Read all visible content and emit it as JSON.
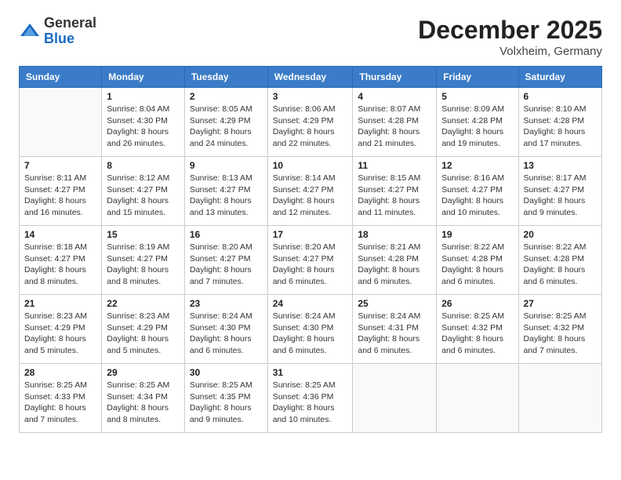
{
  "header": {
    "logo_general": "General",
    "logo_blue": "Blue",
    "month_title": "December 2025",
    "location": "Volxheim, Germany"
  },
  "days_of_week": [
    "Sunday",
    "Monday",
    "Tuesday",
    "Wednesday",
    "Thursday",
    "Friday",
    "Saturday"
  ],
  "weeks": [
    [
      {
        "day": "",
        "info": ""
      },
      {
        "day": "1",
        "info": "Sunrise: 8:04 AM\nSunset: 4:30 PM\nDaylight: 8 hours\nand 26 minutes."
      },
      {
        "day": "2",
        "info": "Sunrise: 8:05 AM\nSunset: 4:29 PM\nDaylight: 8 hours\nand 24 minutes."
      },
      {
        "day": "3",
        "info": "Sunrise: 8:06 AM\nSunset: 4:29 PM\nDaylight: 8 hours\nand 22 minutes."
      },
      {
        "day": "4",
        "info": "Sunrise: 8:07 AM\nSunset: 4:28 PM\nDaylight: 8 hours\nand 21 minutes."
      },
      {
        "day": "5",
        "info": "Sunrise: 8:09 AM\nSunset: 4:28 PM\nDaylight: 8 hours\nand 19 minutes."
      },
      {
        "day": "6",
        "info": "Sunrise: 8:10 AM\nSunset: 4:28 PM\nDaylight: 8 hours\nand 17 minutes."
      }
    ],
    [
      {
        "day": "7",
        "info": "Sunrise: 8:11 AM\nSunset: 4:27 PM\nDaylight: 8 hours\nand 16 minutes."
      },
      {
        "day": "8",
        "info": "Sunrise: 8:12 AM\nSunset: 4:27 PM\nDaylight: 8 hours\nand 15 minutes."
      },
      {
        "day": "9",
        "info": "Sunrise: 8:13 AM\nSunset: 4:27 PM\nDaylight: 8 hours\nand 13 minutes."
      },
      {
        "day": "10",
        "info": "Sunrise: 8:14 AM\nSunset: 4:27 PM\nDaylight: 8 hours\nand 12 minutes."
      },
      {
        "day": "11",
        "info": "Sunrise: 8:15 AM\nSunset: 4:27 PM\nDaylight: 8 hours\nand 11 minutes."
      },
      {
        "day": "12",
        "info": "Sunrise: 8:16 AM\nSunset: 4:27 PM\nDaylight: 8 hours\nand 10 minutes."
      },
      {
        "day": "13",
        "info": "Sunrise: 8:17 AM\nSunset: 4:27 PM\nDaylight: 8 hours\nand 9 minutes."
      }
    ],
    [
      {
        "day": "14",
        "info": "Sunrise: 8:18 AM\nSunset: 4:27 PM\nDaylight: 8 hours\nand 8 minutes."
      },
      {
        "day": "15",
        "info": "Sunrise: 8:19 AM\nSunset: 4:27 PM\nDaylight: 8 hours\nand 8 minutes."
      },
      {
        "day": "16",
        "info": "Sunrise: 8:20 AM\nSunset: 4:27 PM\nDaylight: 8 hours\nand 7 minutes."
      },
      {
        "day": "17",
        "info": "Sunrise: 8:20 AM\nSunset: 4:27 PM\nDaylight: 8 hours\nand 6 minutes."
      },
      {
        "day": "18",
        "info": "Sunrise: 8:21 AM\nSunset: 4:28 PM\nDaylight: 8 hours\nand 6 minutes."
      },
      {
        "day": "19",
        "info": "Sunrise: 8:22 AM\nSunset: 4:28 PM\nDaylight: 8 hours\nand 6 minutes."
      },
      {
        "day": "20",
        "info": "Sunrise: 8:22 AM\nSunset: 4:28 PM\nDaylight: 8 hours\nand 6 minutes."
      }
    ],
    [
      {
        "day": "21",
        "info": "Sunrise: 8:23 AM\nSunset: 4:29 PM\nDaylight: 8 hours\nand 5 minutes."
      },
      {
        "day": "22",
        "info": "Sunrise: 8:23 AM\nSunset: 4:29 PM\nDaylight: 8 hours\nand 5 minutes."
      },
      {
        "day": "23",
        "info": "Sunrise: 8:24 AM\nSunset: 4:30 PM\nDaylight: 8 hours\nand 6 minutes."
      },
      {
        "day": "24",
        "info": "Sunrise: 8:24 AM\nSunset: 4:30 PM\nDaylight: 8 hours\nand 6 minutes."
      },
      {
        "day": "25",
        "info": "Sunrise: 8:24 AM\nSunset: 4:31 PM\nDaylight: 8 hours\nand 6 minutes."
      },
      {
        "day": "26",
        "info": "Sunrise: 8:25 AM\nSunset: 4:32 PM\nDaylight: 8 hours\nand 6 minutes."
      },
      {
        "day": "27",
        "info": "Sunrise: 8:25 AM\nSunset: 4:32 PM\nDaylight: 8 hours\nand 7 minutes."
      }
    ],
    [
      {
        "day": "28",
        "info": "Sunrise: 8:25 AM\nSunset: 4:33 PM\nDaylight: 8 hours\nand 7 minutes."
      },
      {
        "day": "29",
        "info": "Sunrise: 8:25 AM\nSunset: 4:34 PM\nDaylight: 8 hours\nand 8 minutes."
      },
      {
        "day": "30",
        "info": "Sunrise: 8:25 AM\nSunset: 4:35 PM\nDaylight: 8 hours\nand 9 minutes."
      },
      {
        "day": "31",
        "info": "Sunrise: 8:25 AM\nSunset: 4:36 PM\nDaylight: 8 hours\nand 10 minutes."
      },
      {
        "day": "",
        "info": ""
      },
      {
        "day": "",
        "info": ""
      },
      {
        "day": "",
        "info": ""
      }
    ]
  ]
}
